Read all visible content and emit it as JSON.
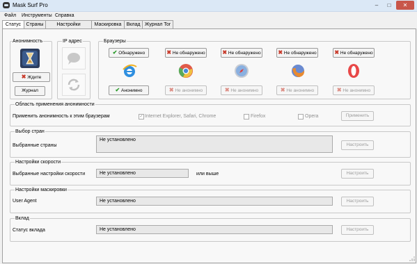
{
  "window": {
    "title": "Mask Surf Pro",
    "controls": {
      "minimize": "–",
      "maximize": "□",
      "close": "✕"
    }
  },
  "menu": [
    "Файл",
    "Инструменты",
    "Справка"
  ],
  "tabs": [
    "Статус",
    "Страны",
    "Настройки скорости",
    "Маскировка",
    "Вклад",
    "Журнал Tor"
  ],
  "anonymity": {
    "title": "Анонимность",
    "wait_button": "Ждите",
    "log_button": "Журнал"
  },
  "ip": {
    "title": "IP адрес"
  },
  "browsers": {
    "title": "Браузеры",
    "items": [
      {
        "name": "Internet Explorer",
        "status": "Обнаружено",
        "anon": "Анонимно",
        "detected": true
      },
      {
        "name": "Chrome",
        "status": "Не обнаружено",
        "anon": "Не анонимно",
        "detected": false
      },
      {
        "name": "Safari",
        "status": "Не обнаружено",
        "anon": "Не анонимно",
        "detected": false
      },
      {
        "name": "Firefox",
        "status": "Не обнаружено",
        "anon": "Не анонимно",
        "detected": false
      },
      {
        "name": "Opera",
        "status": "Не обнаружено",
        "anon": "Не анонимно",
        "detected": false
      }
    ]
  },
  "scope": {
    "title": "Область применения анонимности",
    "label": "Применить анонимность к этим браузерам",
    "opt1": "Internet Explorer, Safari, Chrome",
    "opt2": "Firefox",
    "opt3": "Opera",
    "apply": "Применить"
  },
  "countries": {
    "title": "Выбор стран",
    "label": "Выбранные страны",
    "value": "Не установлено",
    "button": "Настроить"
  },
  "speed": {
    "title": "Настройки скорости",
    "label": "Выбранные настройки скорости",
    "value": "Не установлено",
    "suffix": "или выше",
    "button": "Настроить"
  },
  "mask": {
    "title": "Настройки маскировки",
    "label": "User Agent",
    "value": "Не установлено",
    "button": "Настроить"
  },
  "contribution": {
    "title": "Вклад",
    "label": "Статус вклада",
    "value": "Не установлено",
    "button": "Настроить"
  },
  "colors": {
    "accent": "#2a9a2a",
    "cross": "#c83a2a"
  }
}
